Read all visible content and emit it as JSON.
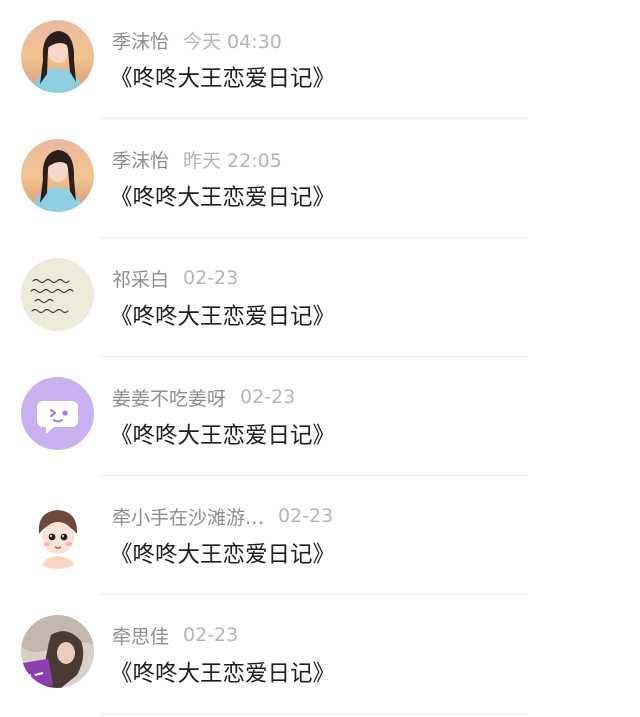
{
  "conversations": [
    {
      "name": "季沫怡",
      "time": "今天 04:30",
      "message": "《咚咚大王恋爱日记》",
      "avatar": "girl-photo-avatar"
    },
    {
      "name": "季沫怡",
      "time": "昨天 22:05",
      "message": "《咚咚大王恋爱日记》",
      "avatar": "girl-photo-avatar"
    },
    {
      "name": "祁采白",
      "time": "02-23",
      "message": "《咚咚大王恋爱日记》",
      "avatar": "handwriting-note-avatar"
    },
    {
      "name": "姜姜不吃姜呀",
      "time": "02-23",
      "message": "《咚咚大王恋爱日记》",
      "avatar": "chat-bubble-avatar"
    },
    {
      "name": "牵小手在沙滩游…",
      "time": "02-23",
      "message": "《咚咚大王恋爱日记》",
      "avatar": "cartoon-boy-avatar"
    },
    {
      "name": "牵思佳",
      "time": "02-23",
      "message": "《咚咚大王恋爱日记》",
      "avatar": "photo-avatar"
    }
  ],
  "colors": {
    "name": "#8e8e8e",
    "time": "#b5b5b5",
    "message": "#1f1f1f",
    "divider": "#eeeeee",
    "chat_bubble_bg": "#c9b0ee"
  }
}
